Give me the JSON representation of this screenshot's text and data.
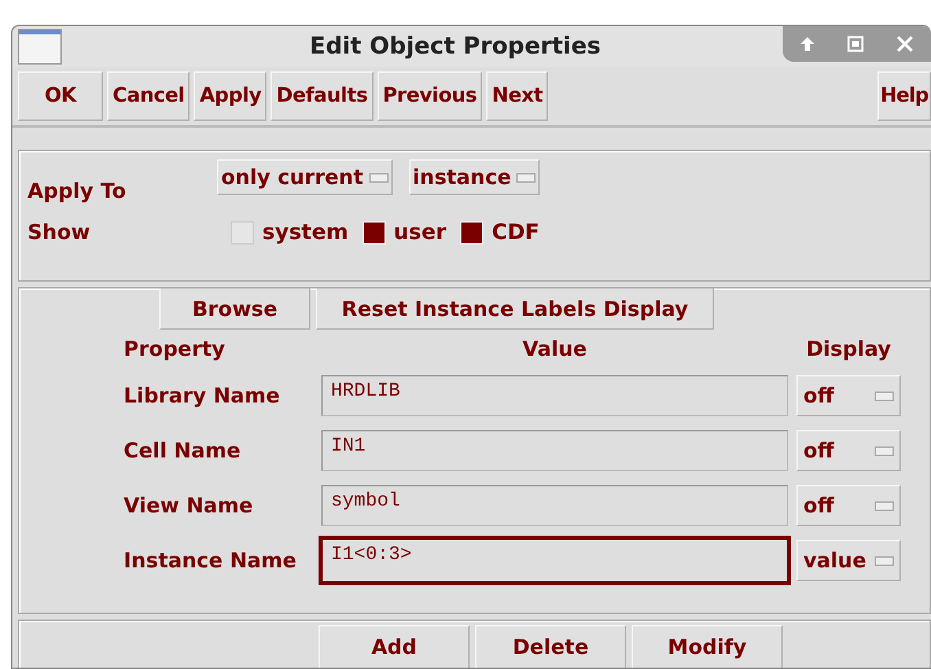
{
  "window": {
    "title": "Edit Object Properties"
  },
  "toolbar": {
    "buttons": [
      "OK",
      "Cancel",
      "Apply",
      "Defaults",
      "Previous",
      "Next"
    ],
    "help": "Help"
  },
  "apply_to": {
    "label": "Apply To",
    "menus": [
      "only current",
      "instance"
    ]
  },
  "show": {
    "label": "Show",
    "options": [
      {
        "label": "system",
        "checked": false
      },
      {
        "label": "user",
        "checked": true
      },
      {
        "label": "CDF",
        "checked": true
      }
    ]
  },
  "actions": [
    "Browse",
    "Reset Instance Labels Display"
  ],
  "columns": [
    "Property",
    "Value",
    "Display"
  ],
  "properties": [
    {
      "name": "Library Name",
      "value": "HRDLIB",
      "display": "off",
      "focused": false
    },
    {
      "name": "Cell Name",
      "value": "IN1",
      "display": "off",
      "focused": false
    },
    {
      "name": "View Name",
      "value": "symbol",
      "display": "off",
      "focused": false
    },
    {
      "name": "Instance Name",
      "value": "I1<0:3>",
      "display": "value",
      "focused": true
    }
  ],
  "bottom_buttons": [
    "Add",
    "Delete",
    "Modify"
  ]
}
